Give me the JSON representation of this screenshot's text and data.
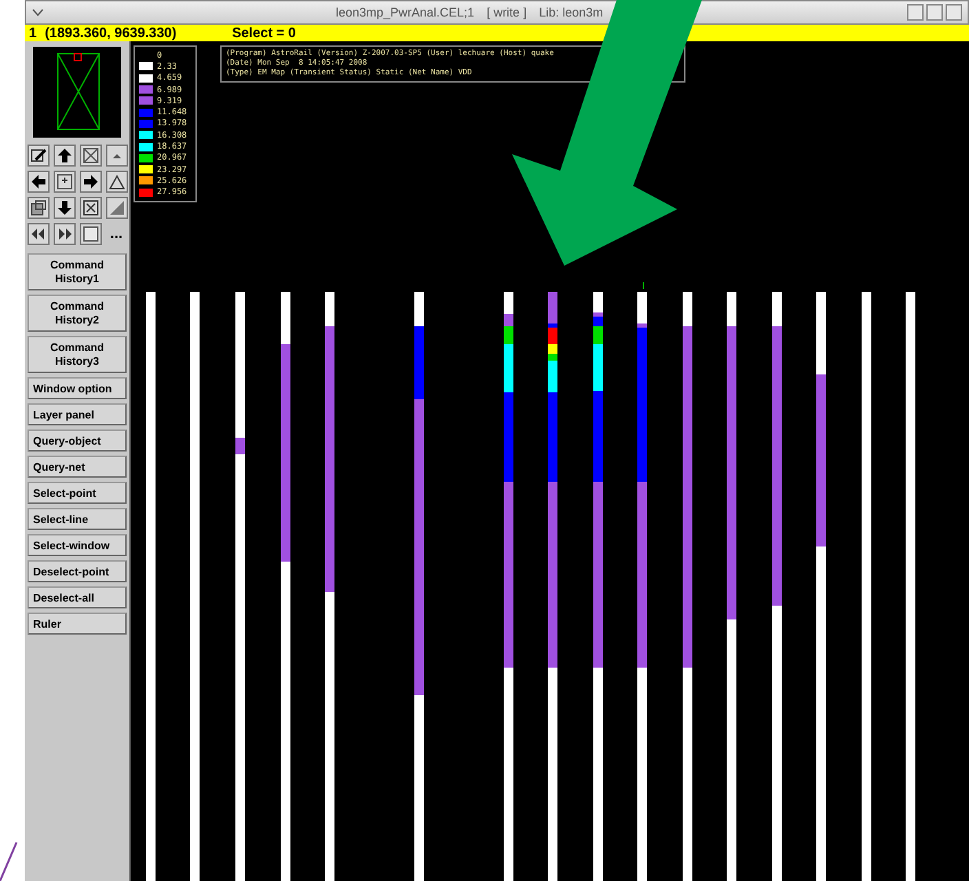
{
  "window": {
    "title": "leon3mp_PwrAnal.CEL;1",
    "mode": "[ write ]",
    "lib": "Lib: leon3m"
  },
  "status_bar": {
    "index": "1",
    "coords": "(1893.360, 9639.330)",
    "select": "Select = 0"
  },
  "toolbar": {
    "more": "..."
  },
  "buttons": [
    {
      "label": "Command History1",
      "kind": "tall"
    },
    {
      "label": "Command History2",
      "kind": "tall"
    },
    {
      "label": "Command History3",
      "kind": "tall"
    },
    {
      "label": "Window option",
      "kind": "flat"
    },
    {
      "label": "Layer panel",
      "kind": "flat"
    },
    {
      "label": "Query-object",
      "kind": "flat"
    },
    {
      "label": "Query-net",
      "kind": "flat"
    },
    {
      "label": "Select-point",
      "kind": "flat"
    },
    {
      "label": "Select-line",
      "kind": "flat"
    },
    {
      "label": "Select-window",
      "kind": "flat"
    },
    {
      "label": "Deselect-point",
      "kind": "flat"
    },
    {
      "label": "Deselect-all",
      "kind": "flat"
    },
    {
      "label": "Ruler",
      "kind": "flat"
    }
  ],
  "legend": [
    {
      "value": "0"
    },
    {
      "value": "2.33",
      "color": "#ffffff"
    },
    {
      "value": "4.659",
      "color": "#ffffff"
    },
    {
      "value": "6.989",
      "color": "#a050e0"
    },
    {
      "value": "9.319",
      "color": "#a050e0"
    },
    {
      "value": "11.648",
      "color": "#0000ff"
    },
    {
      "value": "13.978",
      "color": "#0000ff"
    },
    {
      "value": "16.308",
      "color": "#00ffff"
    },
    {
      "value": "18.637",
      "color": "#00ffff"
    },
    {
      "value": "20.967",
      "color": "#00e000"
    },
    {
      "value": "23.297",
      "color": "#ffff00"
    },
    {
      "value": "25.626",
      "color": "#ff9900"
    },
    {
      "value": "27.956",
      "color": "#ff0000"
    }
  ],
  "info": [
    "(Program) AstroRail (Version) Z-2007.03-SP5 (User) lechuare (Host) quake",
    "(Date) Mon Sep  8 14:05:47 2008",
    "(Type) EM Map (Transient Status) Static (Net Name) VDD"
  ]
}
